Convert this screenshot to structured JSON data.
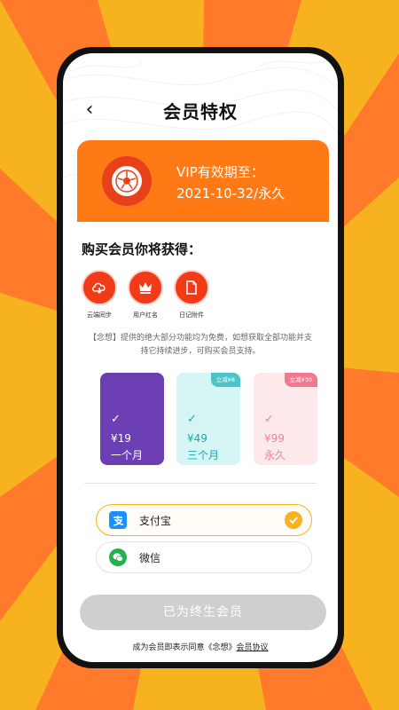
{
  "header": {
    "back_icon": "‹",
    "title": "会员特权"
  },
  "vip": {
    "badge_icon": "soccer-ball-icon",
    "line1": "VIP有效期至：",
    "line2": "2021-10-32/永久"
  },
  "benefits_title": "购买会员你将获得：",
  "benefits": [
    {
      "icon": "cloud-sync-icon",
      "label": "云端同步"
    },
    {
      "icon": "crown-icon",
      "label": "用户红名"
    },
    {
      "icon": "document-icon",
      "label": "日记附件"
    }
  ],
  "description": "【念想】提供的绝大部分功能均为免费，如想获取全部功能并支持它持续进步，可购买会员支持。",
  "plans": [
    {
      "check": "✓",
      "price": "¥19",
      "term": "一个月",
      "tag": ""
    },
    {
      "check": "✓",
      "price": "¥49",
      "term": "三个月",
      "tag": "立减¥8"
    },
    {
      "check": "✓",
      "price": "¥99",
      "term": "永久",
      "tag": "立减¥30"
    }
  ],
  "payment": {
    "alipay": {
      "label": "支付宝",
      "selected": true
    },
    "wechat": {
      "label": "微信",
      "selected": false
    }
  },
  "cta": {
    "label": "已为终生会员"
  },
  "agreement": {
    "prefix": "成为会员即表示同意《念想》",
    "link": "会员协议"
  },
  "colors": {
    "background": "#f6b21f",
    "vip_card": "#ff7a14",
    "benefit_icon": "#f03a18",
    "plan_1": "#6c3fb5",
    "plan_2": "#d6f6f6",
    "plan_3": "#fde9ec",
    "cta_disabled": "#cfcfcf"
  }
}
